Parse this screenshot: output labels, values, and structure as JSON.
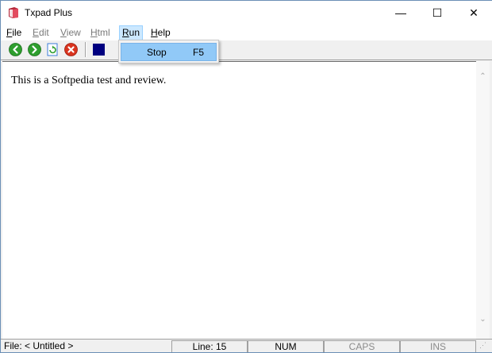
{
  "window": {
    "title": "Txpad Plus",
    "controls": {
      "minimize": "—",
      "maximize": "☐",
      "close": "✕"
    }
  },
  "menubar": {
    "items": [
      {
        "label": "File",
        "mnemonic": "F",
        "rest": "ile",
        "enabled": true
      },
      {
        "label": "Edit",
        "mnemonic": "E",
        "rest": "dit",
        "enabled": false
      },
      {
        "label": "View",
        "mnemonic": "V",
        "rest": "iew",
        "enabled": false
      },
      {
        "label": "Html",
        "mnemonic": "H",
        "rest": "tml",
        "enabled": false
      },
      {
        "label": "Run",
        "mnemonic": "R",
        "rest": "un",
        "enabled": true,
        "open": true
      },
      {
        "label": "Help",
        "mnemonic": "H",
        "rest": "elp",
        "enabled": true
      }
    ]
  },
  "toolbar": {
    "buttons": [
      {
        "icon": "back-arrow-icon",
        "color": "#2e9e2e"
      },
      {
        "icon": "forward-arrow-icon",
        "color": "#2e9e2e"
      },
      {
        "icon": "refresh-icon",
        "color": "#3b7dd8"
      },
      {
        "icon": "stop-icon",
        "color": "#d9341f"
      },
      {
        "icon": "stop-square-icon",
        "color": "#000080"
      }
    ]
  },
  "run_menu": {
    "items": [
      {
        "label": "Stop",
        "shortcut": "F5",
        "highlighted": true
      }
    ]
  },
  "editor": {
    "content": "This is a Softpedia test and review."
  },
  "statusbar": {
    "file": "File: < Untitled >",
    "line": "Line: 15",
    "num": "NUM",
    "caps": "CAPS",
    "ins": "INS"
  },
  "colors": {
    "menu_highlight": "#cce8ff",
    "dropdown_highlight": "#91c9f7"
  }
}
